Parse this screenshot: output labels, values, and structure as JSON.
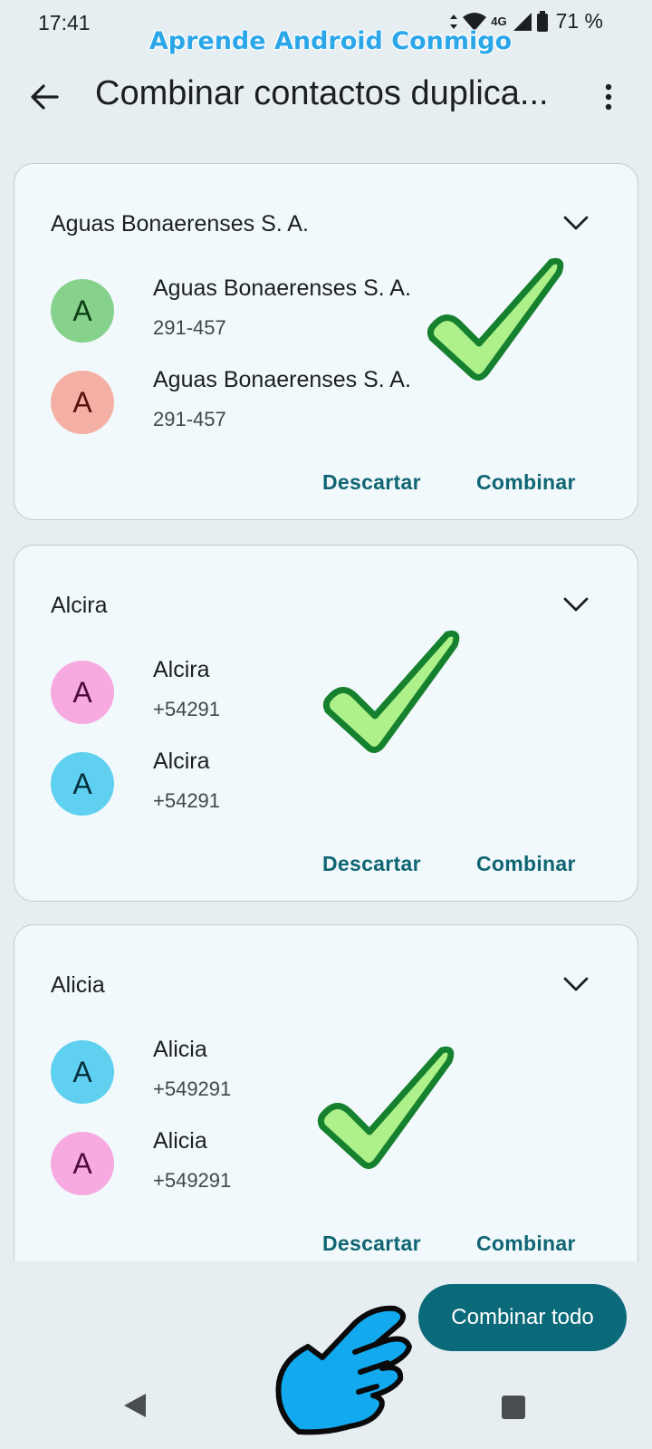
{
  "status_bar": {
    "time": "17:41",
    "network": "4G",
    "battery": "71 %",
    "icons": [
      "data-arrows-icon",
      "wifi-icon",
      "signal-icon",
      "battery-icon"
    ]
  },
  "watermark": "Aprende Android Conmigo",
  "app_bar": {
    "title": "Combinar contactos duplica...",
    "icons": [
      "back-arrow-icon",
      "more-vert-icon"
    ]
  },
  "cards": [
    {
      "title": "Aguas Bonaerenses S. A.",
      "contacts": [
        {
          "initial": "A",
          "name": "Aguas Bonaerenses S. A.",
          "phone": "291-457",
          "avatar_bg": "#86d18c",
          "avatar_fg": "#0b3d14"
        },
        {
          "initial": "A",
          "name": "Aguas Bonaerenses S. A.",
          "phone": "291-457",
          "avatar_bg": "#f5b0a6",
          "avatar_fg": "#5a0f0a"
        }
      ],
      "dismiss": "Descartar",
      "merge": "Combinar"
    },
    {
      "title": "Alcira",
      "contacts": [
        {
          "initial": "A",
          "name": "Alcira",
          "phone": "+54291",
          "avatar_bg": "#f7aadf",
          "avatar_fg": "#4d0b3d"
        },
        {
          "initial": "A",
          "name": "Alcira",
          "phone": "+54291",
          "avatar_bg": "#5fd0f0",
          "avatar_fg": "#062f3d"
        }
      ],
      "dismiss": "Descartar",
      "merge": "Combinar"
    },
    {
      "title": "Alicia",
      "contacts": [
        {
          "initial": "A",
          "name": "Alicia",
          "phone": "+549291",
          "avatar_bg": "#5fd0f0",
          "avatar_fg": "#062f3d"
        },
        {
          "initial": "A",
          "name": "Alicia",
          "phone": "+549291",
          "avatar_bg": "#f7aadf",
          "avatar_fg": "#4d0b3d"
        }
      ],
      "dismiss": "Descartar",
      "merge": "Combinar"
    }
  ],
  "merge_all": "Combinar todo",
  "nav": {
    "icons": [
      "nav-back-icon",
      "nav-recents-icon"
    ]
  },
  "colors": {
    "accent": "#0f6572",
    "fab": "#0b6a79",
    "check_fill": "#aef08a",
    "check_stroke": "#15802e",
    "hand": "#12a9ef"
  }
}
